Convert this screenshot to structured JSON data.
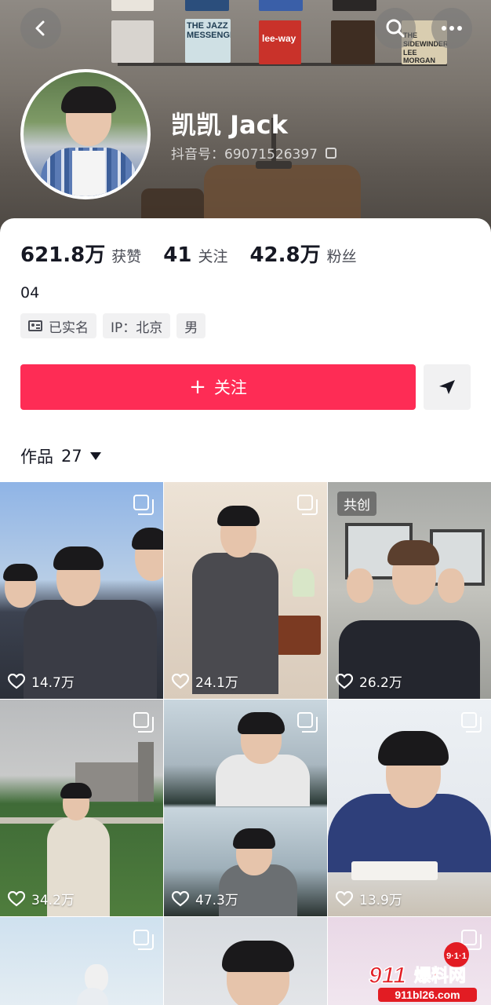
{
  "profile": {
    "username": "凯凯 Jack",
    "douyin_id": "抖音号：69071526397",
    "likes_value": "621.8万",
    "likes_label": "获赞",
    "following_value": "41",
    "following_label": "关注",
    "followers_value": "42.8万",
    "followers_label": "粉丝",
    "bio": "04",
    "tags": [
      "已实名",
      "IP：北京",
      "男"
    ]
  },
  "actions": {
    "follow_label": "关注",
    "follow_plus": "+"
  },
  "works": {
    "label": "作品",
    "count": "27"
  },
  "videos": [
    {
      "likes": "14.7万",
      "badge": ""
    },
    {
      "likes": "24.1万",
      "badge": ""
    },
    {
      "likes": "26.2万",
      "badge": "共创"
    },
    {
      "likes": "34.2万",
      "badge": ""
    },
    {
      "likes": "47.3万",
      "badge": ""
    },
    {
      "likes": "13.9万",
      "badge": ""
    }
  ],
  "banner_albums": [
    "THE JAZZ MESSENGERS",
    "lee-way",
    "THE SIDEWINDER LEE MORGAN"
  ],
  "watermark": {
    "brand_top": "9·1·1",
    "brand": "911爆料网",
    "url": "911bl26.com"
  },
  "colors": {
    "accent": "#fe2c55",
    "text": "#161823",
    "secondary": "#4a4c55",
    "tag_bg": "#f1f1f2"
  },
  "icons": [
    "back-arrow-icon",
    "search-icon",
    "more-icon",
    "copy-icon",
    "id-card-icon",
    "plus-icon",
    "send-icon",
    "caret-down-icon",
    "heart-icon",
    "multi-image-icon"
  ]
}
